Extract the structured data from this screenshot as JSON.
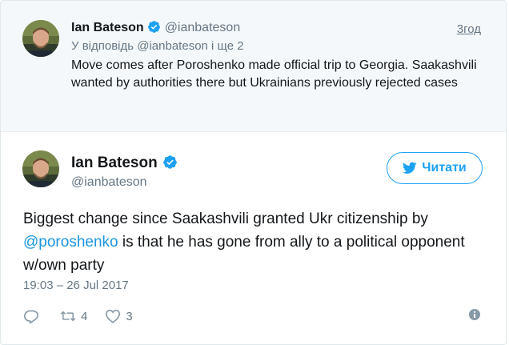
{
  "parent_tweet": {
    "name": "Ian Bateson",
    "handle": "@ianbateson",
    "time": "3год",
    "reply_to": "У відповідь @ianbateson і ще 2",
    "text": "Move comes after Poroshenko made official trip to Georgia. Saakashvili wanted by authorities there but Ukrainians previously rejected cases"
  },
  "main_tweet": {
    "name": "Ian Bateson",
    "handle": "@ianbateson",
    "follow_label": "Читати",
    "text_before": "Biggest change since Saakashvili granted Ukr citizenship by ",
    "mention": "@poroshenko",
    "text_after": " is that he has gone from ally to a political opponent w/own party",
    "date": "19:03 – 26 Jul 2017",
    "retweet_count": "4",
    "like_count": "3"
  },
  "colors": {
    "accent": "#1da1f2",
    "link": "#1b95e0",
    "muted": "#657786",
    "parent_bg": "#f5f8fa"
  },
  "icons": [
    "verified-badge-icon",
    "twitter-bird-icon",
    "reply-icon",
    "retweet-icon",
    "like-heart-icon",
    "more-options-icon"
  ]
}
